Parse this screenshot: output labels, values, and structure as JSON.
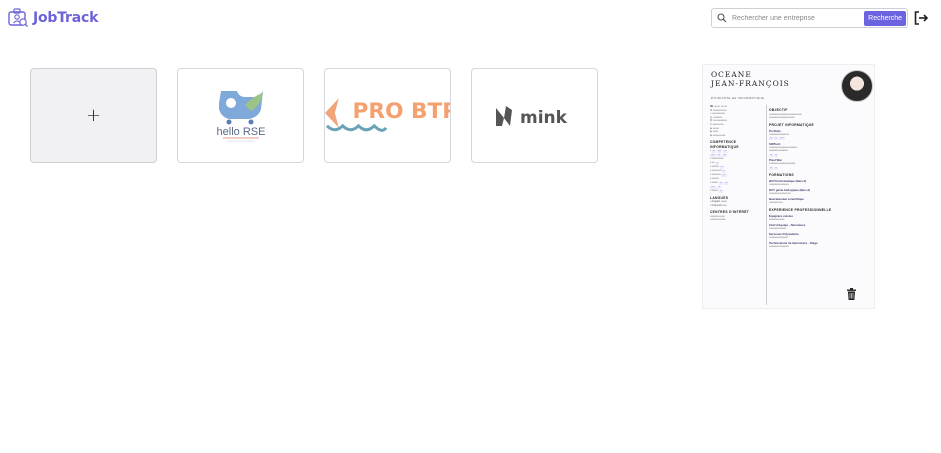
{
  "app": {
    "name": "JobTrack",
    "brand_color": "#6c63d8"
  },
  "search": {
    "placeholder": "Rechercher une entreprise",
    "button_label": "Recherche",
    "icon": "search-icon"
  },
  "header": {
    "logout_icon": "logout-icon"
  },
  "cards": [
    {
      "kind": "add",
      "label": "+"
    },
    {
      "kind": "company",
      "name": "hello RSE",
      "logo_text": "hello RSE"
    },
    {
      "kind": "company",
      "name": "PRO BTP",
      "logo_text": "PRO BTP"
    },
    {
      "kind": "company",
      "name": "mink",
      "logo_text": "mink"
    }
  ],
  "resume": {
    "first_name": "OCEANE",
    "last_name": "JEAN-FRANÇOIS",
    "subtitle": "ÉTUDIANTE EN INFORMATIQUE",
    "sections_left": [
      "COMPETENCE INFORMATIQUE",
      "LANGUES",
      "CENTRES D'INTÉRÊT"
    ],
    "sections_right": [
      "OBJECTIF",
      "PROJET INFORMATIQUE",
      "FORMATIONS",
      "EXPERIENCE PROFESSIONNELLE"
    ],
    "projects": [
      "Portfolio",
      "SIRTech",
      "Pixel War"
    ],
    "formations": [
      "BUT3 Informatique (Bac+3)",
      "DUT génie biologique (Bac+2)",
      "Baccalauréat scientifique"
    ],
    "experiences": [
      "Équipière cuisine",
      "Chef d'équipe - Alternance",
      "Serveuse Polyvalente",
      "Technicienne de laboratoire - Stage"
    ],
    "languages": [
      "Anglais",
      "Français"
    ],
    "delete_icon": "trash-icon"
  }
}
